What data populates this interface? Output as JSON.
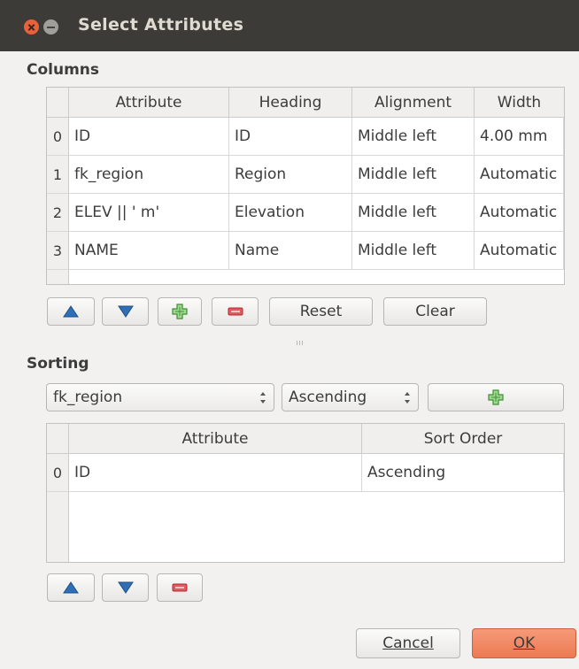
{
  "window": {
    "title": "Select Attributes"
  },
  "columns": {
    "section_title": "Columns",
    "headers": [
      "Attribute",
      "Heading",
      "Alignment",
      "Width"
    ],
    "rows": [
      {
        "num": "0",
        "attribute": "ID",
        "heading": "ID",
        "alignment": "Middle left",
        "width": "4.00 mm"
      },
      {
        "num": "1",
        "attribute": "fk_region",
        "heading": "Region",
        "alignment": "Middle left",
        "width": "Automatic"
      },
      {
        "num": "2",
        "attribute": "ELEV || ' m'",
        "heading": "Elevation",
        "alignment": "Middle left",
        "width": "Automatic"
      },
      {
        "num": "3",
        "attribute": "NAME",
        "heading": "Name",
        "alignment": "Middle left",
        "width": "Automatic"
      }
    ],
    "buttons": {
      "move_up_icon": "triangle-up-icon",
      "move_down_icon": "triangle-down-icon",
      "add_icon": "plus-icon",
      "remove_icon": "minus-icon",
      "reset_label": "Reset",
      "clear_label": "Clear"
    }
  },
  "sorting": {
    "section_title": "Sorting",
    "attribute_combo_value": "fk_region",
    "order_combo_value": "Ascending",
    "headers": [
      "Attribute",
      "Sort Order"
    ],
    "rows": [
      {
        "num": "0",
        "attribute": "ID",
        "sort_order": "Ascending"
      }
    ]
  },
  "footer": {
    "cancel_label": "Cancel",
    "ok_label": "OK"
  },
  "colors": {
    "titlebar": "#3c3b37",
    "close_button": "#e9613a",
    "ok_button": "#ec7a53",
    "add_icon": "#46a53d",
    "remove_icon": "#d73b43",
    "arrow_icon": "#2f6fb5"
  }
}
